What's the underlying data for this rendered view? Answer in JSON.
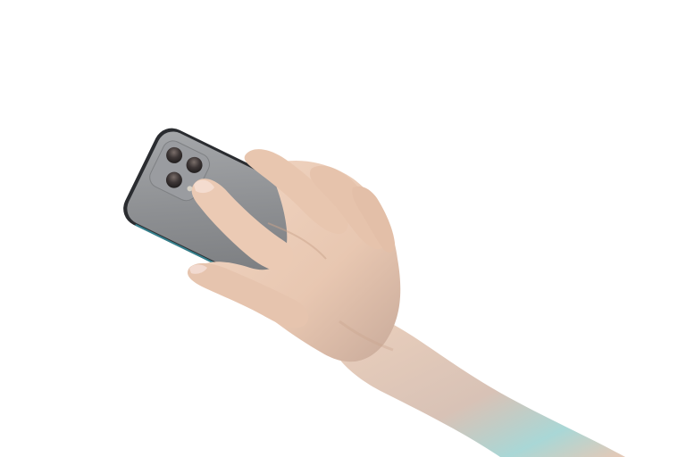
{
  "scene": {
    "subject": "hand-holding-smartphone",
    "background_color": "#ffffff",
    "colors": {
      "phone_body": "#8e9093",
      "phone_edge": "#2a2c30",
      "camera_module": "#9a9ca0",
      "lens": "#3d3a3a",
      "skin": "#e9c9b2",
      "skin_shadow": "#c9a48b",
      "arm_tint": "#9fd6d9",
      "nail": "#f1d7c9"
    },
    "icons": [
      "camera-lens-icon"
    ]
  }
}
